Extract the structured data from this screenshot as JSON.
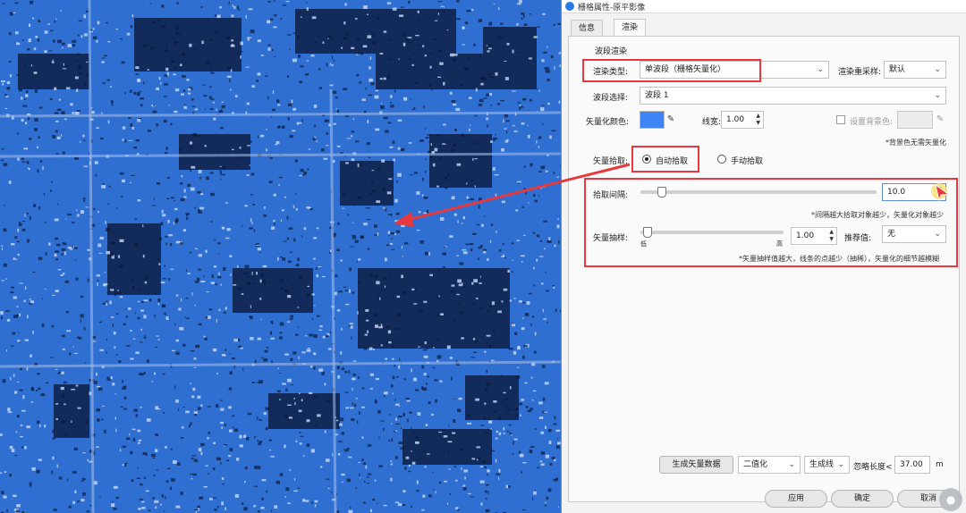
{
  "window": {
    "title": "栅格属性-原平影像"
  },
  "tabs": [
    {
      "label": "信息"
    },
    {
      "label": "渲染",
      "active": true
    }
  ],
  "section": {
    "title": "波段渲染"
  },
  "render_type": {
    "label": "渲染类型:",
    "value": "单波段（栅格矢量化）"
  },
  "resample": {
    "label": "渲染重采样:",
    "value": "默认"
  },
  "band": {
    "label": "波段选择:",
    "value": "波段 1"
  },
  "vector_color": {
    "label": "矢量化颜色:",
    "color": "#3d85f5"
  },
  "line_width": {
    "label": "线宽:",
    "value": "1.00"
  },
  "background": {
    "label": "设置背景色:",
    "checked": false,
    "note": "*背景色无需矢量化"
  },
  "vector_pick": {
    "label": "矢量拾取:",
    "auto_label": "自动拾取",
    "manual_label": "手动拾取",
    "selected": "auto"
  },
  "pick_interval": {
    "label": "拾取间隔:",
    "value": "10.0",
    "level": 0.05,
    "note": "*间隔越大拾取对象越少，矢量化对象越少"
  },
  "vector_sampling": {
    "label": "矢量抽样:",
    "value": "1.00",
    "low": "低",
    "high": "高",
    "level": 0.02,
    "recommend_label": "推荐值:",
    "recommend_value": "无",
    "note": "*矢量抽样值越大，线条的点越少（抽稀），矢量化的细节越模糊"
  },
  "bottom": {
    "generate_button": "生成矢量数据",
    "binarize": "二值化",
    "gen_line": "生成线",
    "ignore_label": "忽略长度<",
    "ignore_value": "37.00",
    "unit": "m"
  },
  "actions": {
    "apply": "应用",
    "ok": "确定",
    "cancel": "取消"
  },
  "colors": {
    "accent": "#e8383d",
    "map_blue": "#2f6fd1"
  }
}
